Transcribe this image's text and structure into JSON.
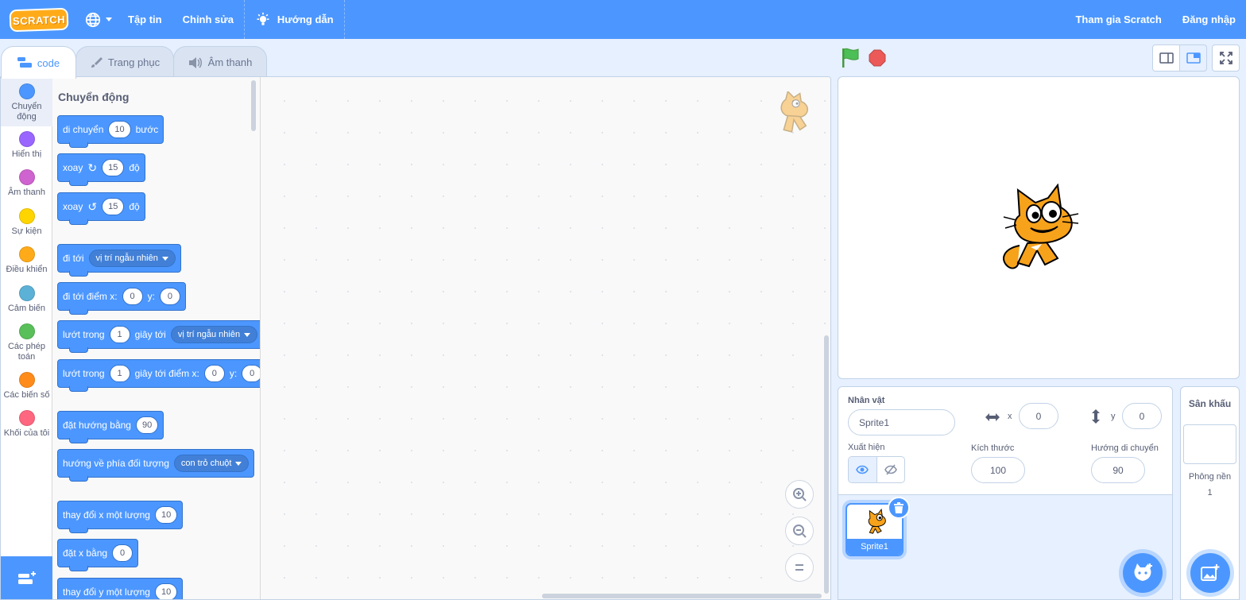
{
  "menu": {
    "logo": "SCRATCH",
    "file": "Tập tin",
    "edit": "Chỉnh sửa",
    "tutorials": "Hướng dẫn",
    "join": "Tham gia Scratch",
    "signin": "Đăng nhập"
  },
  "tabs": {
    "code": "code",
    "costumes": "Trang phục",
    "sounds": "Âm thanh"
  },
  "categories": [
    {
      "label_1": "Chuyển",
      "label_2": "động",
      "color": "#4c97ff"
    },
    {
      "label_1": "Hiển thị",
      "label_2": "",
      "color": "#9966ff"
    },
    {
      "label_1": "Âm thanh",
      "label_2": "",
      "color": "#cf63cf"
    },
    {
      "label_1": "Sự kiện",
      "label_2": "",
      "color": "#ffd500"
    },
    {
      "label_1": "Điều khiển",
      "label_2": "",
      "color": "#ffab19"
    },
    {
      "label_1": "Cảm biến",
      "label_2": "",
      "color": "#5cb1d6"
    },
    {
      "label_1": "Các phép",
      "label_2": "toán",
      "color": "#59c059"
    },
    {
      "label_1": "Các biến số",
      "label_2": "",
      "color": "#ff8c1a"
    },
    {
      "label_1": "Khối của tôi",
      "label_2": "",
      "color": "#ff6680"
    }
  ],
  "palette": {
    "title": "Chuyển động",
    "blocks": {
      "move": {
        "text": "di chuyển",
        "value": "10",
        "suffix": "bước"
      },
      "turn_right": {
        "text": "xoay",
        "value": "15",
        "suffix": "độ"
      },
      "turn_left": {
        "text": "xoay",
        "value": "15",
        "suffix": "độ"
      },
      "goto": {
        "text": "đi tới",
        "option": "vị trí ngẫu nhiên"
      },
      "goto_xy": {
        "text": "đi tới điểm x:",
        "x": "0",
        "ylabel": "y:",
        "y": "0"
      },
      "glide_to": {
        "text": "lướt trong",
        "secs": "1",
        "mid": "giây tới",
        "option": "vị trí ngẫu nhiên"
      },
      "glide_xy": {
        "text": "lướt trong",
        "secs": "1",
        "mid": "giây tới điểm x:",
        "x": "0",
        "ylabel": "y:",
        "y": "0"
      },
      "point_dir": {
        "text": "đặt hướng bằng",
        "value": "90"
      },
      "point_towards": {
        "text": "hướng về phía đối tượng",
        "option": "con trỏ chuột"
      },
      "change_x": {
        "text": "thay đổi x một lượng",
        "value": "10"
      },
      "set_x": {
        "text": "đặt x bằng",
        "value": "0"
      },
      "change_y": {
        "text": "thay đổi y một lượng",
        "value": "10"
      }
    }
  },
  "sprite": {
    "label": "Nhân vật",
    "name": "Sprite1",
    "x_label": "x",
    "x": "0",
    "y_label": "y",
    "y": "0",
    "show_label": "Xuất hiện",
    "size_label": "Kích thước",
    "size": "100",
    "direction_label": "Hướng di chuyển",
    "direction": "90",
    "tile_name": "Sprite1"
  },
  "stage_pane": {
    "title": "Sân khấu",
    "backdrops_label": "Phông nền",
    "backdrops_count": "1"
  },
  "colors": {
    "accent": "#4c97ff",
    "flag": "#4cbf56",
    "stop": "#ec5959",
    "cat_orange": "#f7a21b"
  }
}
